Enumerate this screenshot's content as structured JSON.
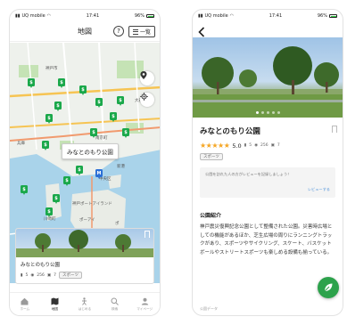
{
  "left": {
    "status": {
      "carrier": "UQ mobile",
      "time": "17:41",
      "battery": "96%"
    },
    "header": {
      "title": "地図",
      "help": "?",
      "list_label": "一覧"
    },
    "map_labels": [
      "神戸市",
      "中央区",
      "兵庫",
      "和田岬",
      "神戸ポートアイランド",
      "ポーアイ",
      "ポ",
      "新港",
      "南京町",
      "大石",
      "川崎町"
    ],
    "callout": "みなとのもり公園",
    "card": {
      "name": "みなとのもり公園",
      "reviews": "5",
      "views": "256",
      "photos": "7",
      "tag": "スポーツ"
    },
    "tabs": [
      {
        "label": "ホーム",
        "icon": "home-icon"
      },
      {
        "label": "地図",
        "icon": "map-icon"
      },
      {
        "label": "はじめる",
        "icon": "start-icon"
      },
      {
        "label": "検索",
        "icon": "search-icon"
      },
      {
        "label": "マイページ",
        "icon": "user-icon"
      }
    ],
    "colors": {
      "marker": "#1aa84a",
      "marker_blue": "#2a6fd6"
    }
  },
  "right": {
    "status": {
      "carrier": "UQ mobile",
      "time": "17:41",
      "battery": "96%"
    },
    "title": "みなとのもり公園",
    "rating": "5.0",
    "stars": "★★★★★",
    "reviews": "5",
    "views": "256",
    "photos": "7",
    "tag": "スポーツ",
    "review_prompt": "公園を訪れた人の方がレビューを記録しましょう！",
    "review_link": "レビューする",
    "section_head": "公園紹介",
    "description": "神戸震災復興記念公園として整備された公園。災害時広場としての機能があるほか、芝生広場の周りにランニングトラックがあり、スポーツやサイクリング、スケート、バスケットボールやストリートスポーツも楽しめる設備も揃っている。",
    "bottom_peek": "公園データ",
    "colors": {
      "star": "#f5a623",
      "fab": "#2ca24b"
    }
  }
}
